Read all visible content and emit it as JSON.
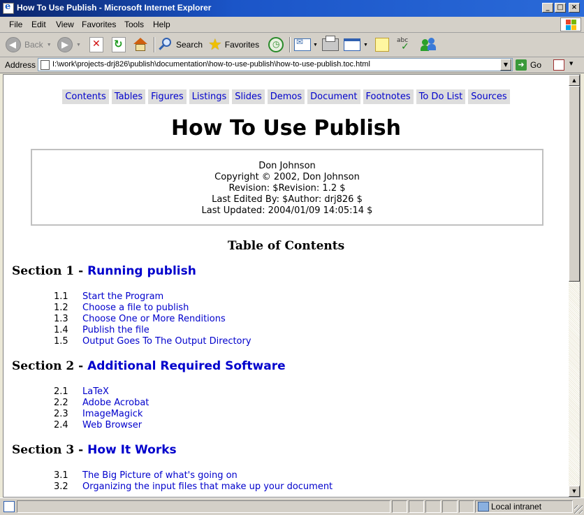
{
  "window": {
    "title": "How To Use Publish - Microsoft Internet Explorer",
    "minimize": "_",
    "maximize": "□",
    "close": "×"
  },
  "menu": [
    "File",
    "Edit",
    "View",
    "Favorites",
    "Tools",
    "Help"
  ],
  "toolbar": {
    "back": "Back",
    "search": "Search",
    "favorites": "Favorites"
  },
  "address": {
    "label": "Address",
    "url": "I:\\work\\projects-drj826\\publish\\documentation\\how-to-use-publish\\how-to-use-publish.toc.html",
    "go": "Go"
  },
  "nav": [
    "Contents",
    "Tables",
    "Figures",
    "Listings",
    "Slides",
    "Demos",
    "Document",
    "Footnotes",
    "To Do List",
    "Sources"
  ],
  "doc": {
    "title": "How To Use Publish",
    "author": "Don Johnson",
    "copyright": "Copyright © 2002, Don Johnson",
    "revision": "Revision: $Revision: 1.2 $",
    "edited_by": "Last Edited By: $Author: drj826 $",
    "updated": "Last Updated: 2004/01/09 14:05:14 $",
    "toc_heading": "Table of Contents"
  },
  "sections": [
    {
      "prefix": "Section 1 - ",
      "title": "Running publish",
      "items": [
        {
          "num": "1.1",
          "label": "Start the Program"
        },
        {
          "num": "1.2",
          "label": "Choose a file to publish"
        },
        {
          "num": "1.3",
          "label": "Choose One or More Renditions"
        },
        {
          "num": "1.4",
          "label": "Publish the file"
        },
        {
          "num": "1.5",
          "label": "Output Goes To The Output Directory"
        }
      ]
    },
    {
      "prefix": "Section 2 - ",
      "title": "Additional Required Software",
      "items": [
        {
          "num": "2.1",
          "label": "LaTeX"
        },
        {
          "num": "2.2",
          "label": "Adobe Acrobat"
        },
        {
          "num": "2.3",
          "label": "ImageMagick"
        },
        {
          "num": "2.4",
          "label": "Web Browser"
        }
      ]
    },
    {
      "prefix": "Section 3 - ",
      "title": "How It Works",
      "items": [
        {
          "num": "3.1",
          "label": "The Big Picture of what's going on"
        },
        {
          "num": "3.2",
          "label": "Organizing the input files that make up your document"
        }
      ]
    }
  ],
  "status": {
    "zone": "Local intranet"
  },
  "colors": {
    "link": "#0000cc",
    "nav_bg": "#dddddd",
    "titlebar": "#0a246a",
    "chrome": "#d4d0c8"
  }
}
